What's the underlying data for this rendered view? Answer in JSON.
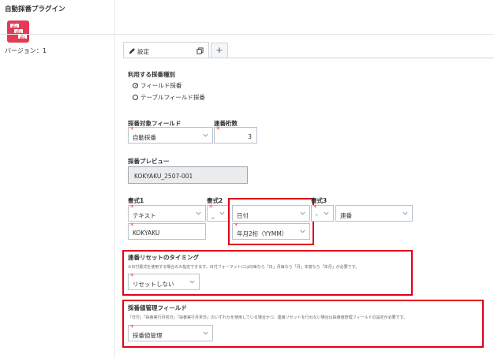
{
  "plugin": {
    "title": "自動採番プラグイン",
    "icon_name": "plugin-documents-icon",
    "icon_color": "#e33b55",
    "icon_texts": [
      "2-001",
      "2-001",
      "2-001"
    ],
    "version_label": "バージョン：1"
  },
  "tab": {
    "label": "設定",
    "add_label": "+"
  },
  "type_section": {
    "label": "利用する採番種別",
    "options": [
      {
        "label": "フィールド採番",
        "selected": true
      },
      {
        "label": "テーブルフィールド採番",
        "selected": false
      }
    ]
  },
  "target_field": {
    "label": "採番対象フィールド",
    "value": "自動採番"
  },
  "digits": {
    "label": "連番桁数",
    "value": "3"
  },
  "preview": {
    "label": "採番プレビュー",
    "value": "KOKYAKU_2507-001"
  },
  "format1": {
    "label": "書式1",
    "type": "テキスト",
    "text": "KOKYAKU"
  },
  "format2": {
    "label": "書式2",
    "separator": "_",
    "type": "日付",
    "date_format": "年月2桁（YYMM）"
  },
  "format3": {
    "label": "書式3",
    "separator": "-",
    "type": "連番"
  },
  "reset": {
    "label": "連番リセットのタイミング",
    "note": "※日付書式を使用する場合のみ指定できます。日付フォーマットには日毎なら「日」月毎なら「月」年度なら「年月」が必要です。",
    "value": "リセットしない"
  },
  "mgmt": {
    "label": "採番値管理フィールド",
    "note": "「日付」「採番実行月初日」「採番実行月末日」のいずれかを使用している場合かつ、連番リセットを行わない場合は採番値管理フィールドの設定が必要です。",
    "value": "採番値管理"
  },
  "colors": {
    "highlight": "#e0001b",
    "required": "#e74c3c"
  }
}
